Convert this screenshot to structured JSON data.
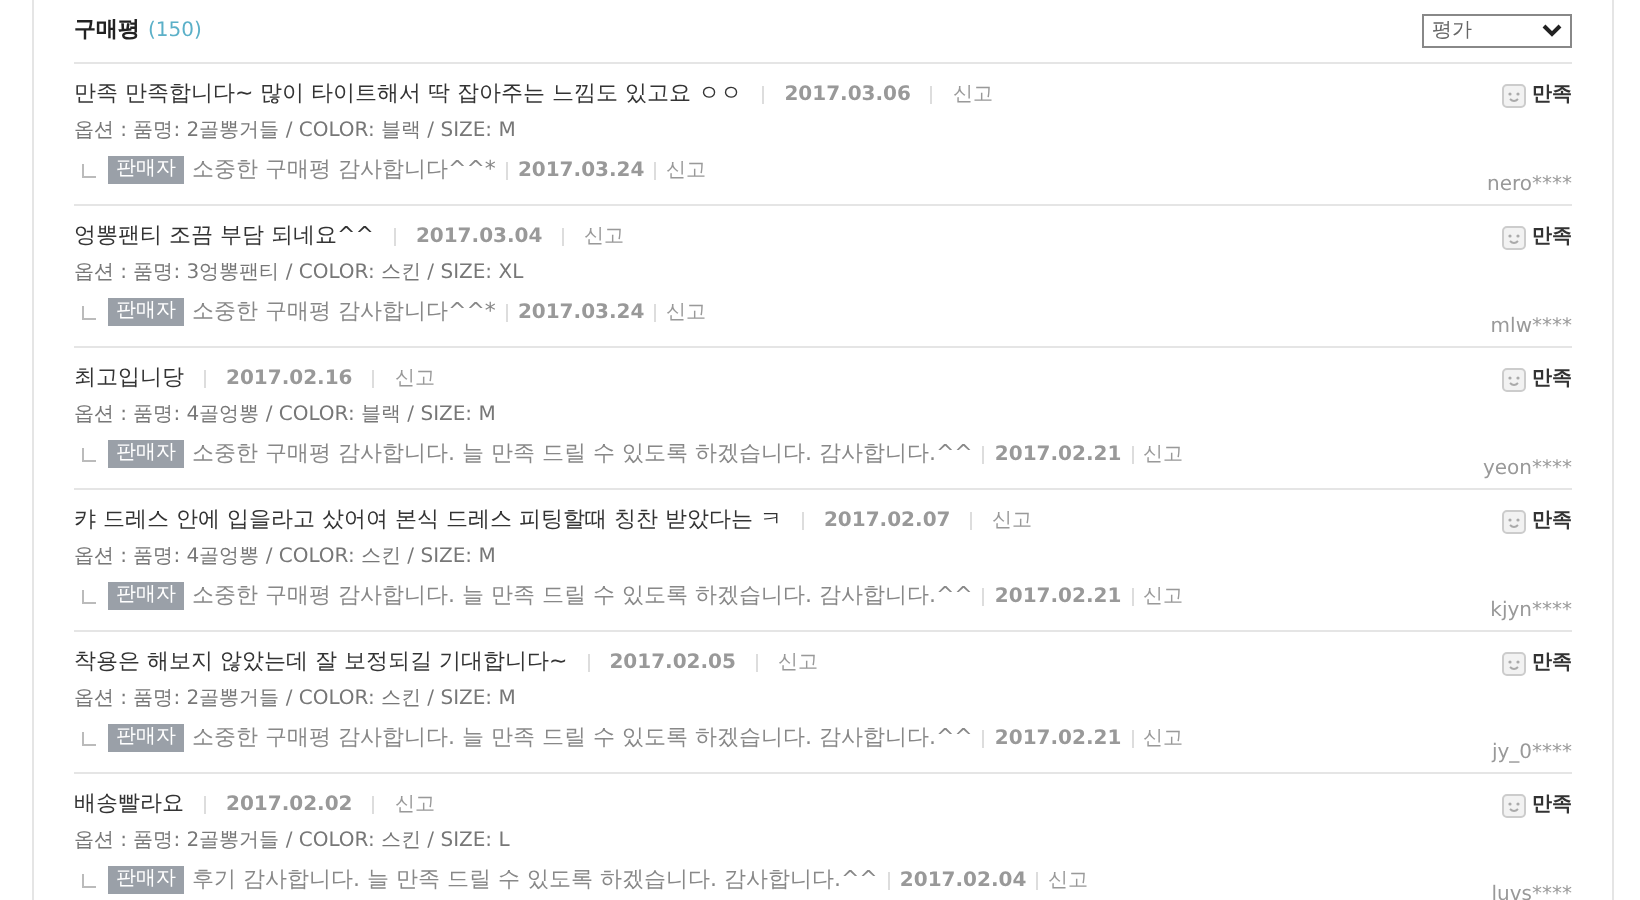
{
  "header": {
    "title": "구매평",
    "count": "(150)",
    "sort_select": {
      "value": "평가"
    }
  },
  "reviews": [
    {
      "text": "만족 만족합니다~ 많이 타이트해서 딱 잡아주는 느낌도 있고요 ㅇㅇ",
      "date": "2017.03.06",
      "report": "신고",
      "option": "옵션 : 품명: 2골뽕거들 / COLOR: 블랙 / SIZE: M",
      "reply": {
        "badge": "판매자",
        "text": "소중한 구매평 감사합니다^^*",
        "date": "2017.03.24",
        "report": "신고"
      },
      "rating": "만족",
      "user": "nero****"
    },
    {
      "text": "엉뽕팬티 조끔 부담 되네요^^",
      "date": "2017.03.04",
      "report": "신고",
      "option": "옵션 : 품명: 3엉뽕팬티 / COLOR: 스킨 / SIZE: XL",
      "reply": {
        "badge": "판매자",
        "text": "소중한 구매평 감사합니다^^*",
        "date": "2017.03.24",
        "report": "신고"
      },
      "rating": "만족",
      "user": "mlw****"
    },
    {
      "text": "최고입니당",
      "date": "2017.02.16",
      "report": "신고",
      "option": "옵션 : 품명: 4골엉뽕 / COLOR: 블랙 / SIZE: M",
      "reply": {
        "badge": "판매자",
        "text": "소중한 구매평 감사합니다. 늘 만족 드릴 수 있도록 하겠습니다. 감사합니다.^^",
        "date": "2017.02.21",
        "report": "신고"
      },
      "rating": "만족",
      "user": "yeon****"
    },
    {
      "text": "캬 드레스 안에 입을라고 샀어여 본식 드레스 피팅할때 칭찬 받았다는 ㅋ",
      "date": "2017.02.07",
      "report": "신고",
      "option": "옵션 : 품명: 4골엉뽕 / COLOR: 스킨 / SIZE: M",
      "reply": {
        "badge": "판매자",
        "text": "소중한 구매평 감사합니다. 늘 만족 드릴 수 있도록 하겠습니다. 감사합니다.^^",
        "date": "2017.02.21",
        "report": "신고"
      },
      "rating": "만족",
      "user": "kjyn****"
    },
    {
      "text": "착용은 해보지 않았는데 잘 보정되길 기대합니다~",
      "date": "2017.02.05",
      "report": "신고",
      "option": "옵션 : 품명: 2골뽕거들 / COLOR: 스킨 / SIZE: M",
      "reply": {
        "badge": "판매자",
        "text": "소중한 구매평 감사합니다. 늘 만족 드릴 수 있도록 하겠습니다. 감사합니다.^^",
        "date": "2017.02.21",
        "report": "신고"
      },
      "rating": "만족",
      "user": "jy_0****"
    },
    {
      "text": "배송빨라요",
      "date": "2017.02.02",
      "report": "신고",
      "option": "옵션 : 품명: 2골뽕거들 / COLOR: 스킨 / SIZE: L",
      "reply": {
        "badge": "판매자",
        "text": "후기 감사합니다. 늘 만족 드릴 수 있도록 하겠습니다. 감사합니다.^^",
        "date": "2017.02.04",
        "report": "신고"
      },
      "rating": "만족",
      "user": "luvs****"
    }
  ]
}
